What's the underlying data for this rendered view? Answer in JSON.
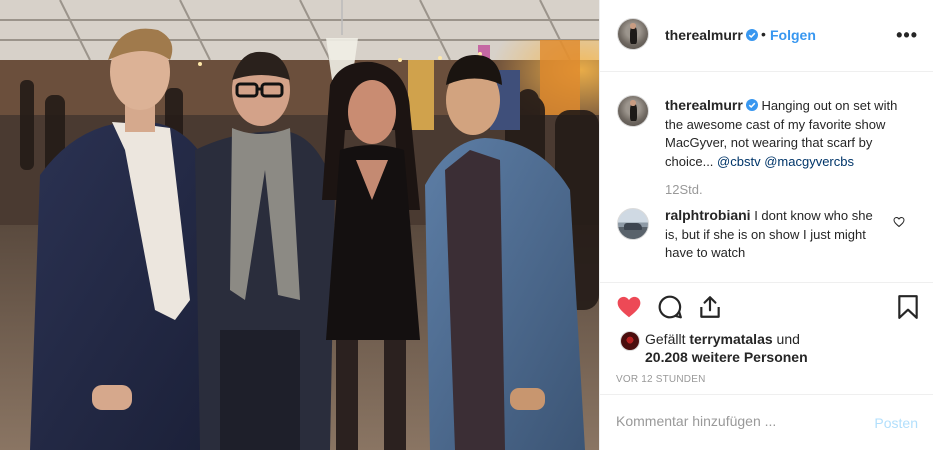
{
  "post": {
    "author": "therealmurr",
    "follow_separator": "•",
    "follow_label": "Folgen",
    "more_icon": "more-horizontal-icon",
    "caption": {
      "username": "therealmurr",
      "text": "Hanging out on set with the awesome cast of my favorite show MacGyver, not wearing that scarf by choice...",
      "mentions": [
        "@cbstv",
        "@macgyvercbs"
      ]
    },
    "time_ago": "12Std.",
    "comments": [
      {
        "username": "ralphtrobiani",
        "text": "I dont know who she is, but if she is on show I just might have to watch"
      }
    ],
    "likes": {
      "prefix": "Gefällt",
      "user": "terrymatalas",
      "conjunction": "und",
      "others": "20.208 weitere Personen"
    },
    "posted_ago": "VOR 12 STUNDEN",
    "add_comment": {
      "placeholder": "Kommentar hinzufügen ...",
      "post_label": "Posten"
    },
    "liked": true
  },
  "colors": {
    "link_blue": "#3897f0",
    "heart_red": "#ed4956",
    "mention": "#003569",
    "muted": "#999999",
    "post_disabled": "#b2dffc",
    "verified_blue": "#3897f0"
  }
}
